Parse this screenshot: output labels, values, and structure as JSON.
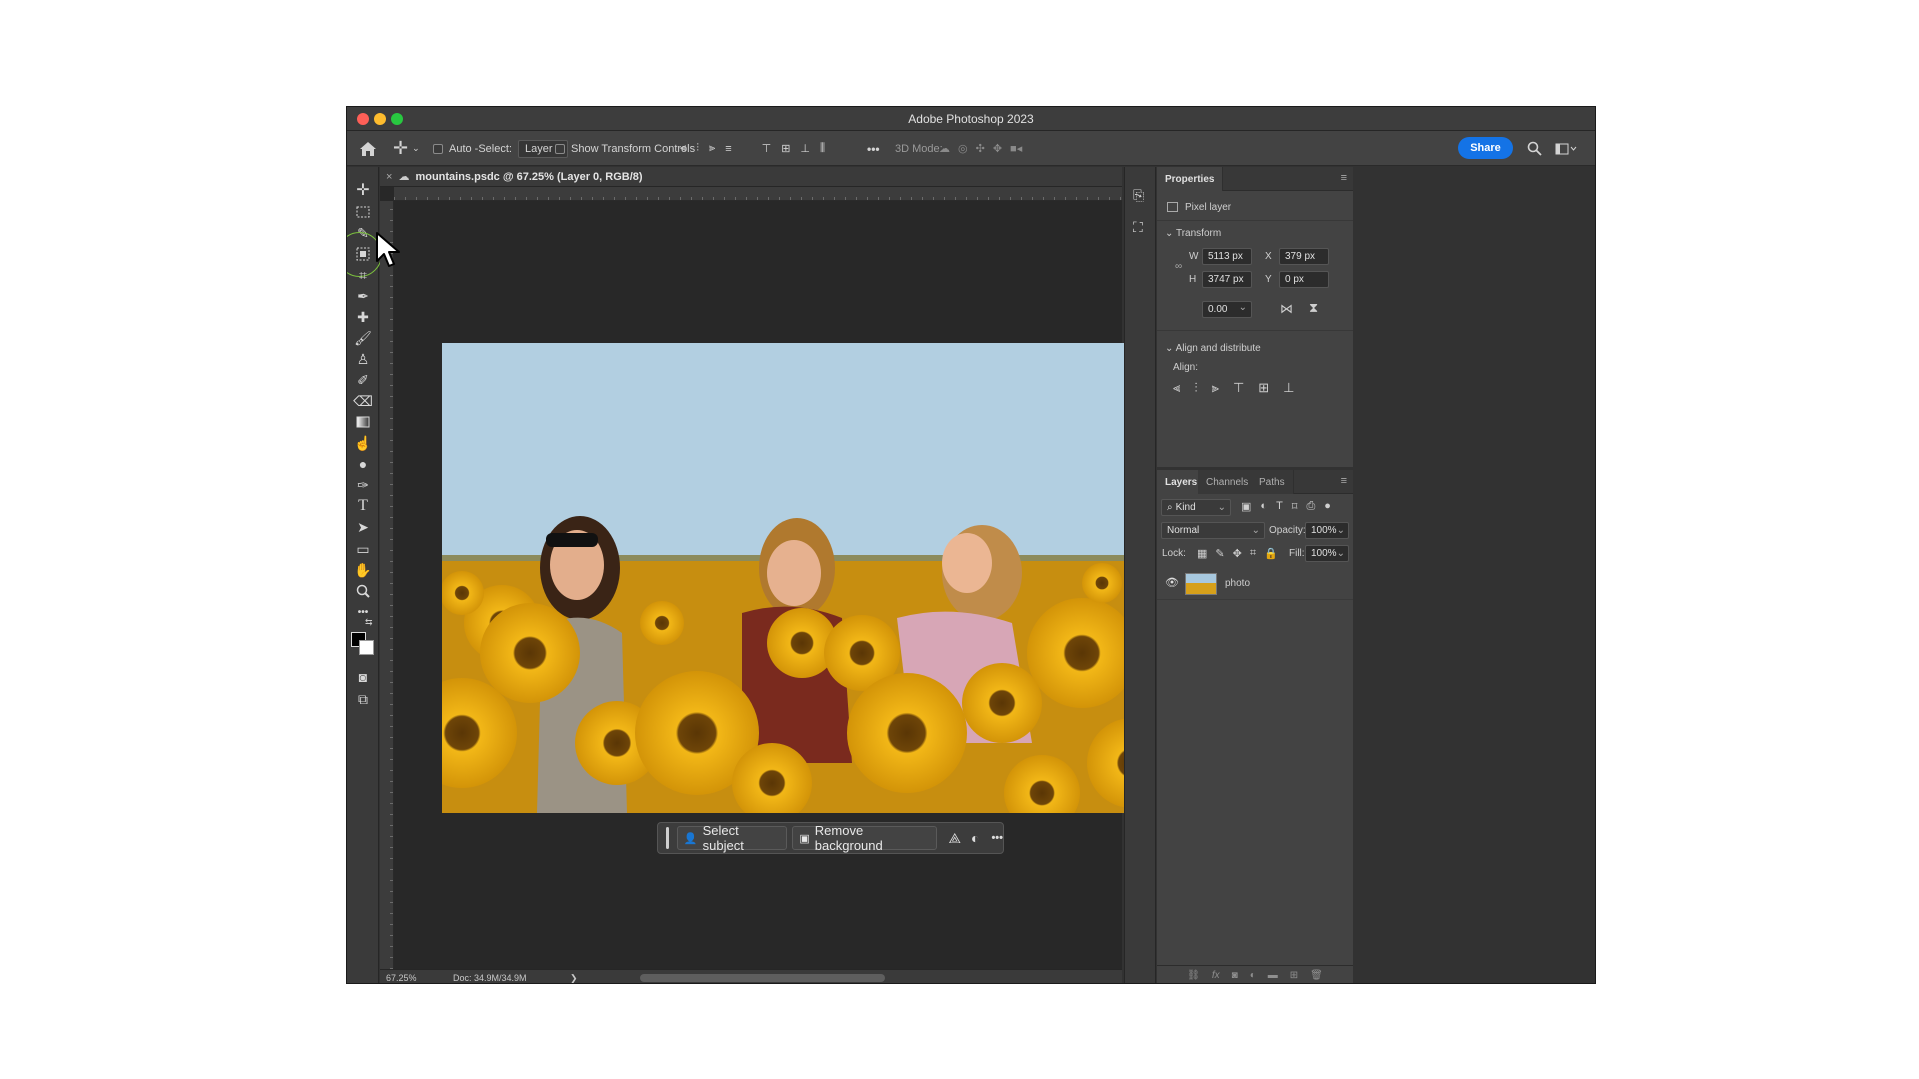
{
  "window": {
    "title": "Adobe Photoshop 2023"
  },
  "options_bar": {
    "auto_select_label": "Auto -Select:",
    "auto_select_value": "Layer",
    "show_transform_label": "Show Transform Controls",
    "mode_3d_label": "3D Mode:",
    "share_label": "Share",
    "more_label": "•••"
  },
  "document": {
    "tab_title": "mountains.psdc @ 67.25% (Layer 0, RGB/8)",
    "close_label": "×"
  },
  "toolbar": {
    "tools": [
      "move-tool",
      "marquee-tool",
      "lasso-tool",
      "object-selection-tool",
      "crop-tool",
      "eyedropper-tool",
      "healing-tool",
      "brush-tool",
      "clone-stamp-tool",
      "history-brush-tool",
      "eraser-tool",
      "gradient-tool",
      "smudge-tool",
      "dodge-tool",
      "pen-tool",
      "type-tool",
      "path-selection-tool",
      "rectangle-tool",
      "hand-tool",
      "zoom-tool",
      "more-tools"
    ],
    "type_glyph": "T",
    "more_glyph": "•••"
  },
  "context_bar": {
    "select_subject_label": "Select subject",
    "remove_background_label": "Remove background",
    "more_label": "•••"
  },
  "status_bar": {
    "zoom": "67.25%",
    "doc_size": "Doc: 34.9M/34.9M",
    "arrow": "❯"
  },
  "properties": {
    "tab_label": "Properties",
    "layer_type": "Pixel layer",
    "transform_label": "Transform",
    "w_label": "W",
    "w_value": "5113 px",
    "h_label": "H",
    "h_value": "3747 px",
    "x_label": "X",
    "x_value": "379 px",
    "y_label": "Y",
    "y_value": "0 px",
    "angle_value": "0.00",
    "align_section_label": "Align and distribute",
    "align_label": "Align:"
  },
  "layers_panel": {
    "tabs": [
      "Layers",
      "Channels",
      "Paths"
    ],
    "kind_label": "Kind",
    "blend_mode": "Normal",
    "opacity_label": "Opacity:",
    "opacity_value": "100%",
    "lock_label": "Lock:",
    "fill_label": "Fill:",
    "fill_value": "100%",
    "layer_name": "photo",
    "fx_label": "fx"
  },
  "colors": {
    "accent": "#1473e6",
    "highlight_ring": "#7cc13e",
    "traffic_red": "#fe5f57",
    "traffic_yellow": "#febc2e",
    "traffic_green": "#28c840"
  }
}
